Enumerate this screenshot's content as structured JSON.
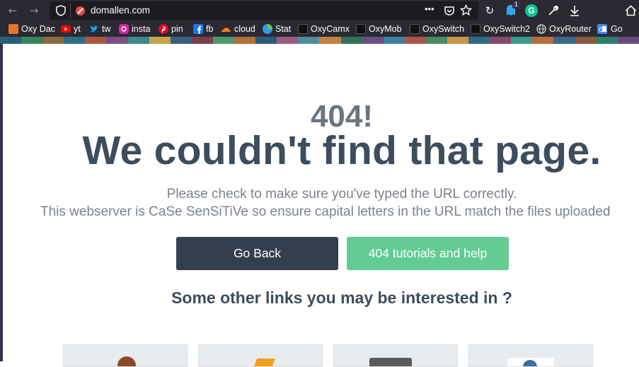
{
  "browser": {
    "url": "domallen.com",
    "menu_dots": "•••",
    "notification_count": "1",
    "bookmarks": [
      {
        "label": "Oxy Dac",
        "icon": "orange-square-icon",
        "color": "#e8752a"
      },
      {
        "label": "yt",
        "icon": "youtube-icon",
        "color": "#ff0000"
      },
      {
        "label": "tw",
        "icon": "twitter-icon",
        "color": "#1da1f2"
      },
      {
        "label": "insta",
        "icon": "instagram-icon",
        "color": "#d6249f"
      },
      {
        "label": "pin",
        "icon": "pinterest-icon",
        "color": "#e60023"
      },
      {
        "label": "fb",
        "icon": "facebook-icon",
        "color": "#1877f2"
      },
      {
        "label": "cloud",
        "icon": "cloud-icon",
        "color": "#f38020"
      },
      {
        "label": "Stat",
        "icon": "stat-icon",
        "color": "#2a9df4"
      },
      {
        "label": "OxyCamx",
        "icon": "oxy-icon",
        "color": "#111111"
      },
      {
        "label": "OxyMob",
        "icon": "oxy-icon",
        "color": "#111111"
      },
      {
        "label": "OxySwitch",
        "icon": "oxy-icon",
        "color": "#111111"
      },
      {
        "label": "OxySwitch2",
        "icon": "oxy-icon",
        "color": "#111111"
      },
      {
        "label": "OxyRouter",
        "icon": "globe-icon",
        "color": "#cfd0d4"
      },
      {
        "label": "Go",
        "icon": "google-icon",
        "color": "#4285f4"
      }
    ]
  },
  "page": {
    "error_code": "404!",
    "title": "We couldn't find that page.",
    "message_line1": "Please check to make sure you've typed the URL correctly.",
    "message_line2": "This webserver is CaSe SenSiTiVe so ensure capital letters in the URL match the files uploaded",
    "go_back_label": "Go Back",
    "help_label": "404 tutorials and help",
    "links_heading": "Some other links you may be interested in ?"
  },
  "colors": {
    "title": "#3d4d5d",
    "go_back_bg": "#343f4e",
    "help_bg": "#62cc92"
  }
}
